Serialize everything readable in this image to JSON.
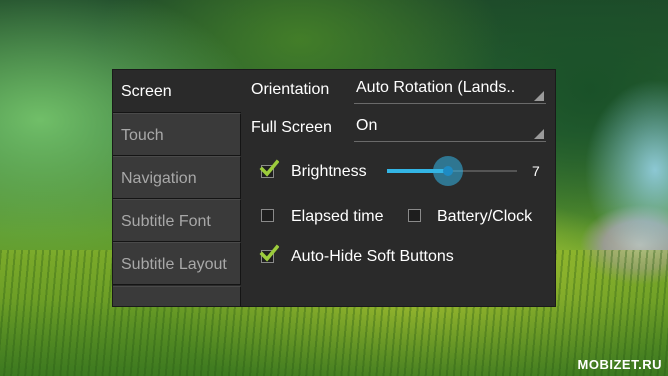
{
  "tabs": [
    {
      "label": "Screen",
      "active": true
    },
    {
      "label": "Touch",
      "active": false
    },
    {
      "label": "Navigation",
      "active": false
    },
    {
      "label": "Subtitle Font",
      "active": false
    },
    {
      "label": "Subtitle Layout",
      "active": false
    }
  ],
  "screen": {
    "orientation": {
      "label": "Orientation",
      "value": "Auto Rotation (Lands.."
    },
    "full_screen": {
      "label": "Full Screen",
      "value": "On"
    },
    "brightness": {
      "label": "Brightness",
      "checked": true,
      "value": "7",
      "level_fraction": 0.47
    },
    "elapsed_time": {
      "label": "Elapsed time",
      "checked": false
    },
    "battery_clock": {
      "label": "Battery/Clock",
      "checked": false
    },
    "auto_hide": {
      "label": "Auto-Hide Soft Buttons",
      "checked": true
    }
  },
  "watermark": "MOBIZET.RU",
  "colors": {
    "accent": "#33b5e5",
    "check": "#9ccc3c",
    "panel": "#2a2a2a"
  }
}
